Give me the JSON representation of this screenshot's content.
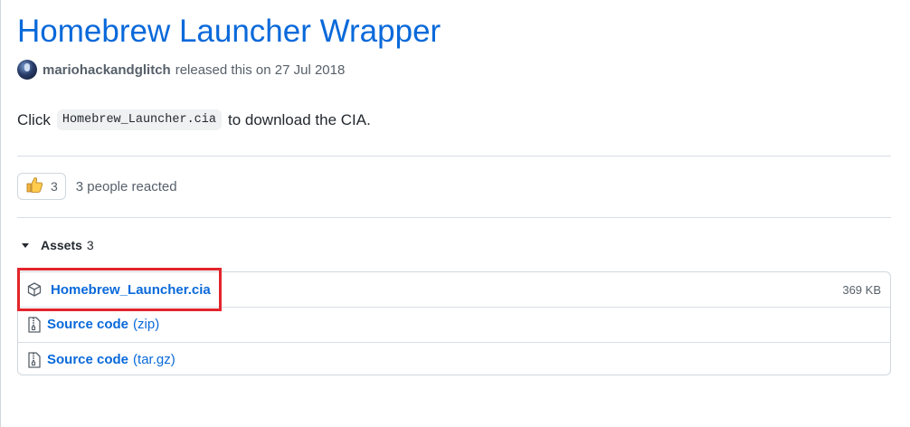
{
  "release": {
    "title": "Homebrew Launcher Wrapper",
    "author": "mariohackandglitch",
    "released_text": "released this on 27 Jul 2018"
  },
  "description": {
    "prefix": "Click",
    "code": "Homebrew_Launcher.cia",
    "suffix": "to download the CIA."
  },
  "reactions": {
    "emoji_icon": "thumbs-up-icon",
    "count": "3",
    "text": "3 people reacted"
  },
  "assets": {
    "label": "Assets",
    "count": "3",
    "items": [
      {
        "name": "Homebrew_Launcher.cia",
        "suffix": "",
        "size": "369 KB",
        "icon": "package-icon"
      },
      {
        "name": "Source code",
        "suffix": "(zip)",
        "size": "",
        "icon": "file-zip-icon"
      },
      {
        "name": "Source code",
        "suffix": "(tar.gz)",
        "size": "",
        "icon": "file-zip-icon"
      }
    ]
  },
  "colors": {
    "link": "#0969da",
    "highlight": "#e3242b"
  }
}
